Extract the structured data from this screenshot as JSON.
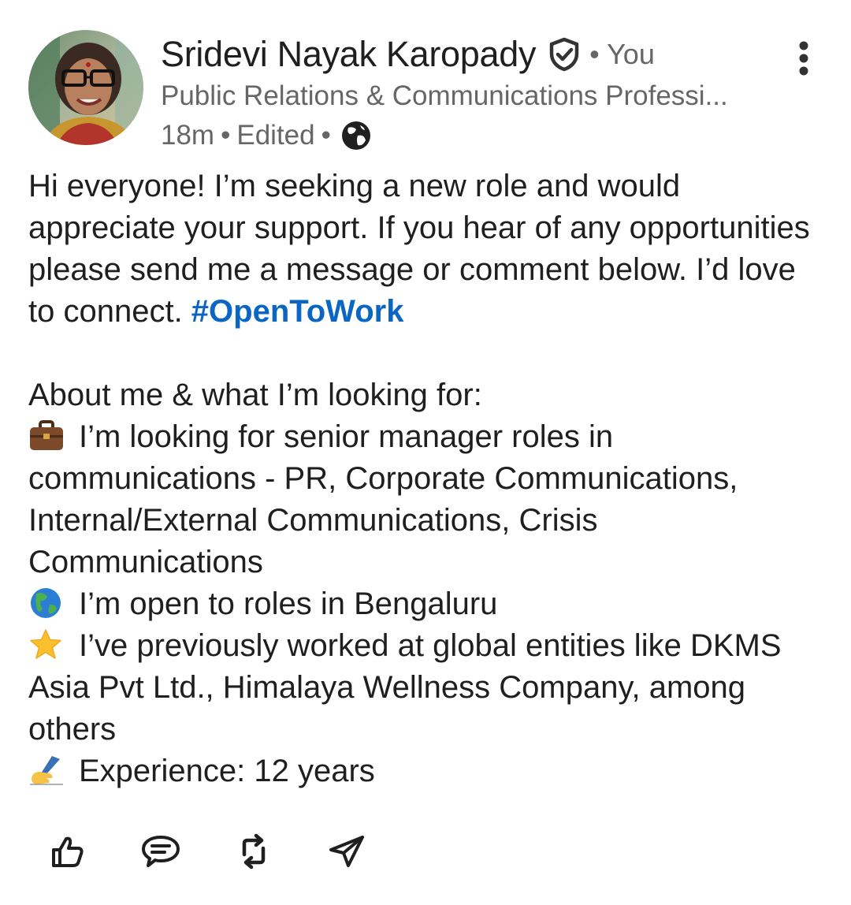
{
  "post": {
    "author": {
      "name": "Sridevi Nayak Karopady",
      "relation": "• You",
      "headline": "Public Relations & Communications Professi...",
      "time": "18m",
      "edited": "Edited",
      "visibility_icon": "globe-icon",
      "verified_icon": "verified-shield-icon"
    },
    "body": {
      "intro": "Hi everyone! I’m seeking a new role and would appreciate your support. If you hear of any opportunities please send me a message or comment below. I’d love to connect. ",
      "hashtag": "#OpenToWork",
      "about_heading": "About me & what I’m looking for:",
      "items": [
        {
          "icon": "briefcase-icon",
          "text": "I’m looking for senior manager roles  in communications - PR, Corporate Communications, Internal/External Communications, Crisis Communications"
        },
        {
          "icon": "globe-americas-icon",
          "text": "I’m open to roles in Bengaluru"
        },
        {
          "icon": "star-icon",
          "text": "I’ve previously worked at global entities like DKMS Asia Pvt Ltd., Himalaya Wellness Company, among others"
        },
        {
          "icon": "writing-hand-icon",
          "text": "Experience: 12 years"
        }
      ]
    },
    "actions": [
      {
        "icon": "like-icon"
      },
      {
        "icon": "comment-icon"
      },
      {
        "icon": "repost-icon"
      },
      {
        "icon": "send-icon"
      }
    ],
    "colors": {
      "hashtag": "#0a66c2",
      "secondary_text": "#666666",
      "primary_text": "#1f1f1f"
    }
  }
}
